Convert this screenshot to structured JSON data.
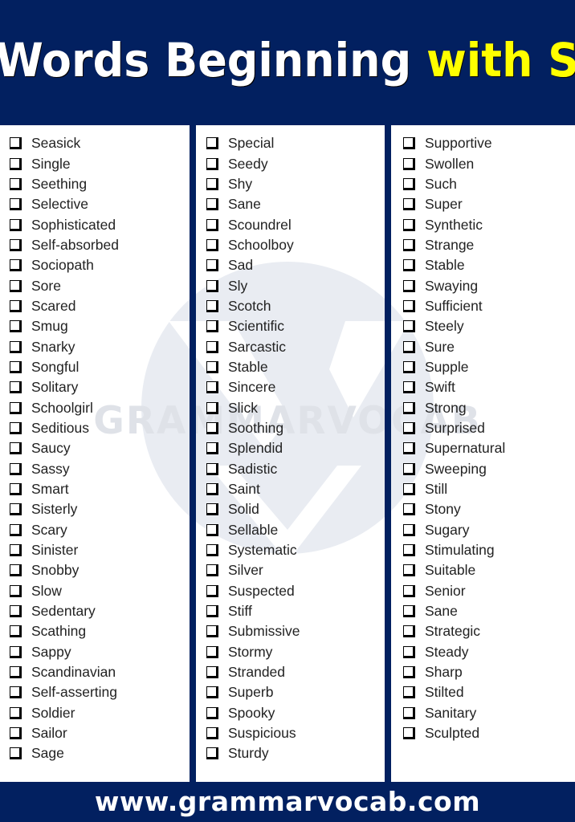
{
  "header": {
    "title_main": "Words Beginning ",
    "title_highlight": "with S",
    "colors": {
      "background": "#022060",
      "title": "#ffffff",
      "highlight": "#ffff00"
    }
  },
  "watermark": {
    "text": "GRAMMARVOCAB",
    "color": "#e6e9f0"
  },
  "columns": [
    {
      "items": [
        "Seasick",
        "Single",
        "Seething",
        "Selective",
        "Sophisticated",
        "Self-absorbed",
        "Sociopath",
        "Sore",
        "Scared",
        "Smug",
        "Snarky",
        "Songful",
        "Solitary",
        "Schoolgirl",
        "Seditious",
        "Saucy",
        "Sassy",
        "Smart",
        "Sisterly",
        "Scary",
        "Sinister",
        "Snobby",
        "Slow",
        "Sedentary",
        "Scathing",
        "Sappy",
        "Scandinavian",
        "Self-asserting",
        "Soldier",
        "Sailor",
        "Sage"
      ]
    },
    {
      "items": [
        "Special",
        "Seedy",
        "Shy",
        "Sane",
        "Scoundrel",
        "Schoolboy",
        "Sad",
        "Sly",
        "Scotch",
        "Scientific",
        "Sarcastic",
        "Stable",
        "Sincere",
        "Slick",
        "Soothing",
        "Splendid",
        "Sadistic",
        "Saint",
        "Solid",
        "Sellable",
        "Systematic",
        "Silver",
        "Suspected",
        "Stiff",
        "Submissive",
        "Stormy",
        "Stranded",
        "Superb",
        "Spooky",
        "Suspicious",
        "Sturdy"
      ]
    },
    {
      "items": [
        "Supportive",
        "Swollen",
        "Such",
        "Super",
        "Synthetic",
        "Strange",
        "Stable",
        "Swaying",
        "Sufficient",
        "Steely",
        "Sure",
        "Supple",
        "Swift",
        "Strong",
        "Surprised",
        "Supernatural",
        "Sweeping",
        "Still",
        "Stony",
        "Sugary",
        "Stimulating",
        "Suitable",
        "Senior",
        "Sane",
        "Strategic",
        "Steady",
        "Sharp",
        "Stilted",
        "Sanitary",
        "Sculpted"
      ]
    }
  ],
  "footer": {
    "url": "www.grammarvocab.com"
  }
}
